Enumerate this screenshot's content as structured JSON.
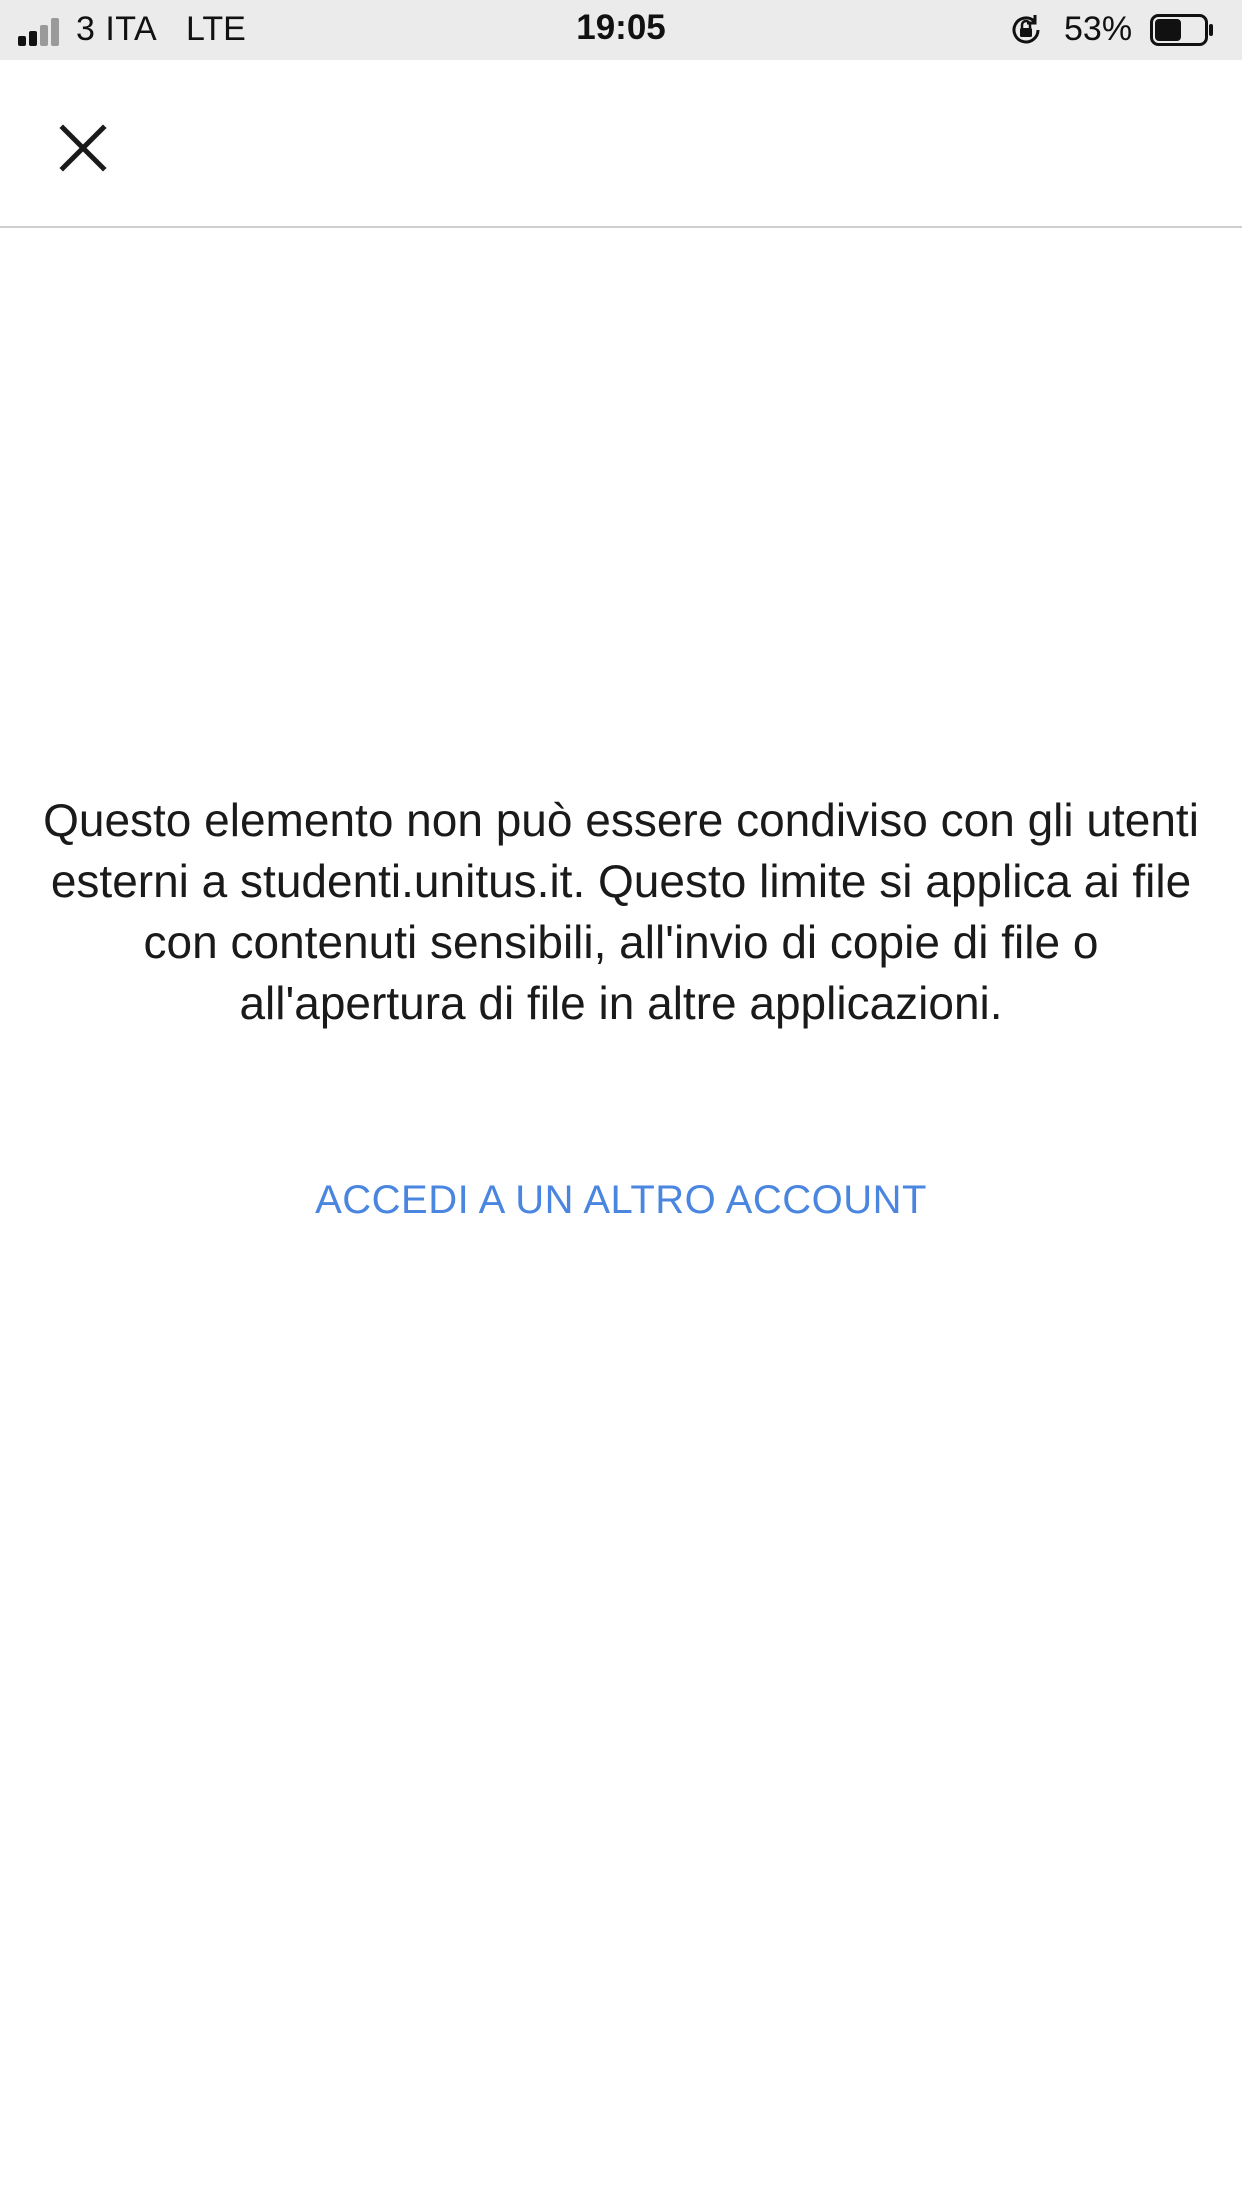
{
  "status_bar": {
    "carrier": "3 ITA",
    "network": "LTE",
    "time": "19:05",
    "battery_percent": "53%",
    "battery_level": 0.53,
    "signal_bars_active": 2,
    "signal_bars_total": 4,
    "icons": [
      "signal-icon",
      "lock-rotation-icon",
      "battery-icon"
    ]
  },
  "header": {
    "close_icon": "close-icon"
  },
  "main": {
    "message": "Questo elemento non può essere condiviso con gli utenti esterni a studenti.unitus.it. Questo limite si applica ai file con contenuti sensibili, all'invio di copie di file o all'apertura di file in altre applicazioni.",
    "switch_account_label": "ACCEDI A UN ALTRO ACCOUNT"
  },
  "colors": {
    "status_bar_bg": "#ebebeb",
    "text": "#1a1a1a",
    "link": "#4a86e0",
    "divider": "#cfcfcf"
  }
}
